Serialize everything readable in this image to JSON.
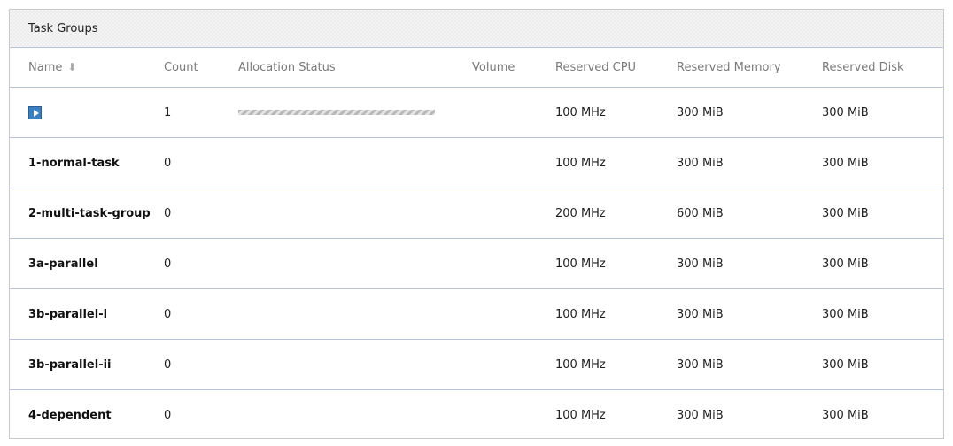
{
  "panel": {
    "title": "Task Groups"
  },
  "table": {
    "headers": {
      "name": "Name",
      "count": "Count",
      "allocation_status": "Allocation Status",
      "volume": "Volume",
      "reserved_cpu": "Reserved CPU",
      "reserved_memory": "Reserved Memory",
      "reserved_disk": "Reserved Disk"
    },
    "rows": [
      {
        "name": "",
        "count": "1",
        "volume": "",
        "cpu": "100 MHz",
        "memory": "300 MiB",
        "disk": "300 MiB",
        "icon": "play-icon",
        "allocation_bar": true
      },
      {
        "name": "1-normal-task",
        "count": "0",
        "volume": "",
        "cpu": "100 MHz",
        "memory": "300 MiB",
        "disk": "300 MiB"
      },
      {
        "name": "2-multi-task-group",
        "count": "0",
        "volume": "",
        "cpu": "200 MHz",
        "memory": "600 MiB",
        "disk": "300 MiB"
      },
      {
        "name": "3a-parallel",
        "count": "0",
        "volume": "",
        "cpu": "100 MHz",
        "memory": "300 MiB",
        "disk": "300 MiB"
      },
      {
        "name": "3b-parallel-i",
        "count": "0",
        "volume": "",
        "cpu": "100 MHz",
        "memory": "300 MiB",
        "disk": "300 MiB"
      },
      {
        "name": "3b-parallel-ii",
        "count": "0",
        "volume": "",
        "cpu": "100 MHz",
        "memory": "300 MiB",
        "disk": "300 MiB"
      },
      {
        "name": "4-dependent",
        "count": "0",
        "volume": "",
        "cpu": "100 MHz",
        "memory": "300 MiB",
        "disk": "300 MiB"
      }
    ]
  },
  "colors": {
    "divider": "#b7c3d8",
    "play_icon": "#3a7fc1",
    "header_text": "#7a7a7a"
  }
}
